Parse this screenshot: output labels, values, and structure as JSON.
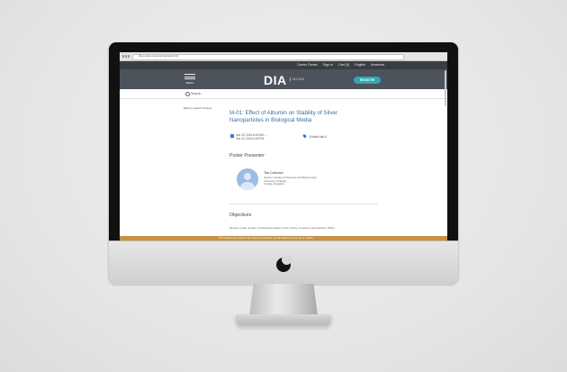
{
  "browser": {
    "url": "dia.s-tools.org/event/posters/m01"
  },
  "topbar": {
    "links": [
      "Career Center",
      "Sign In",
      "Cart (0)",
      "English",
      "Americas"
    ]
  },
  "header": {
    "menu_label": "MENU",
    "logo": "DIA",
    "logo_sub": "DIA 2016",
    "register_label": "REGISTER"
  },
  "search": {
    "placeholder": "Search"
  },
  "nav": {
    "back_label": "Back to Search Posters"
  },
  "poster": {
    "title": "M-01: Effect of Albumin on Stability of Silver Nanoparticles in Biological Media",
    "date_line1": "Jun 15, 2016 8:00 AM –",
    "date_line2": "Jun 15, 2016 4:00 PM",
    "location": "Exhibit Hall A"
  },
  "presenter": {
    "heading": "Poster Presenter",
    "name": "Tea Crnkovic",
    "affiliation": [
      "Student, Faculty of Pharmacy and Biochemistry",
      "University of Zagreb",
      "Croatia (Hrvatska)"
    ]
  },
  "objectives": {
    "heading": "Objectives",
    "text": "Despite a vast number of biological studies of the toxicity of various nanoparticles (NPs),"
  },
  "cookie": {
    "text": "This website uses cookies. By continuing to browse, you are agreeing to our use of cookies."
  },
  "colors": {
    "header": "#4d535c",
    "accent": "#2fa7b5",
    "title": "#3a6fa3",
    "cookie": "#c79242"
  }
}
